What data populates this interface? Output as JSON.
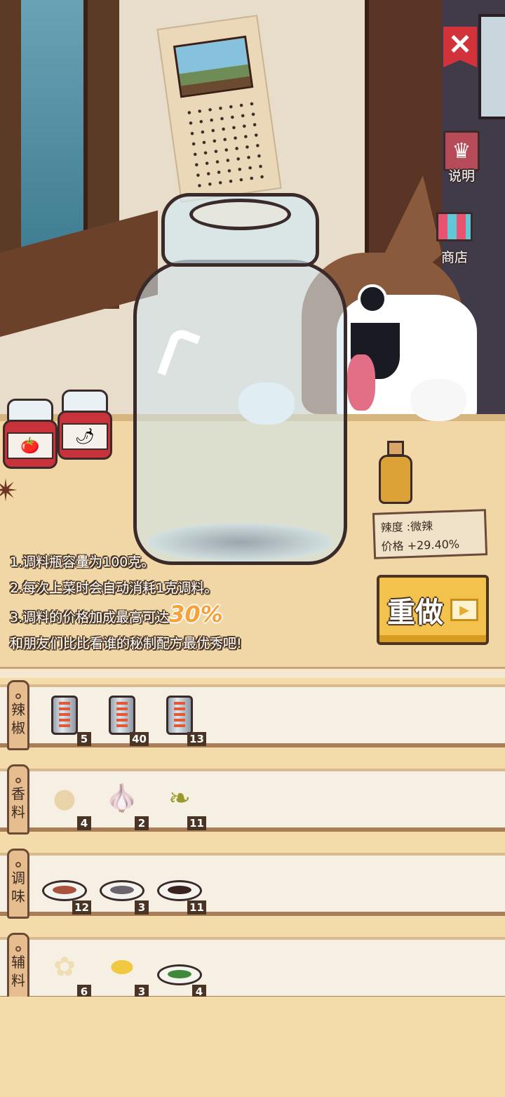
{
  "header": {
    "close_icon": "close-x-icon",
    "help_button": {
      "label": "说明",
      "icon": "book-icon"
    },
    "shop_button": {
      "label": "商店",
      "icon": "shop-icon"
    }
  },
  "status": {
    "spice_label": "辣度",
    "spice_value": ":微辣",
    "price_label": "价格",
    "price_value": "+29.40%"
  },
  "tips": {
    "line1": "1.调料瓶容量为100克。",
    "line2": "2.每次上菜时会自动消耗1克调料。",
    "line3_prefix": "3.调料的价格加成最高可达",
    "line3_highlight": "30%",
    "line4": "和朋友们比比看谁的秘制配方最优秀吧!"
  },
  "redo_button": {
    "label": "重做"
  },
  "shelves": [
    {
      "tag_top": "辣",
      "tag_bottom": "椒",
      "items": [
        {
          "icon": "chili-can-icon",
          "qty": "5"
        },
        {
          "icon": "chili-can-icon",
          "qty": "40"
        },
        {
          "icon": "chili-can-icon",
          "qty": "13"
        }
      ]
    },
    {
      "tag_top": "香",
      "tag_bottom": "料",
      "items": [
        {
          "icon": "ginger-icon",
          "qty": "4"
        },
        {
          "icon": "garlic-icon",
          "qty": "2"
        },
        {
          "icon": "pepper-icon",
          "qty": "11"
        }
      ]
    },
    {
      "tag_top": "调",
      "tag_bottom": "味",
      "items": [
        {
          "icon": "sauce-dish-icon",
          "qty": "12"
        },
        {
          "icon": "sauce-dish-icon",
          "qty": "3"
        },
        {
          "icon": "sauce-dish-icon",
          "qty": "11"
        }
      ]
    },
    {
      "tag_top": "辅",
      "tag_bottom": "料",
      "items": [
        {
          "icon": "ginger-root-icon",
          "qty": "6"
        },
        {
          "icon": "lemon-slice-icon",
          "qty": "3"
        },
        {
          "icon": "herb-dish-icon",
          "qty": "4"
        }
      ]
    }
  ],
  "colors": {
    "accent": "#f2c24c",
    "highlight": "#f7a13a",
    "close_red": "#d2323a"
  }
}
